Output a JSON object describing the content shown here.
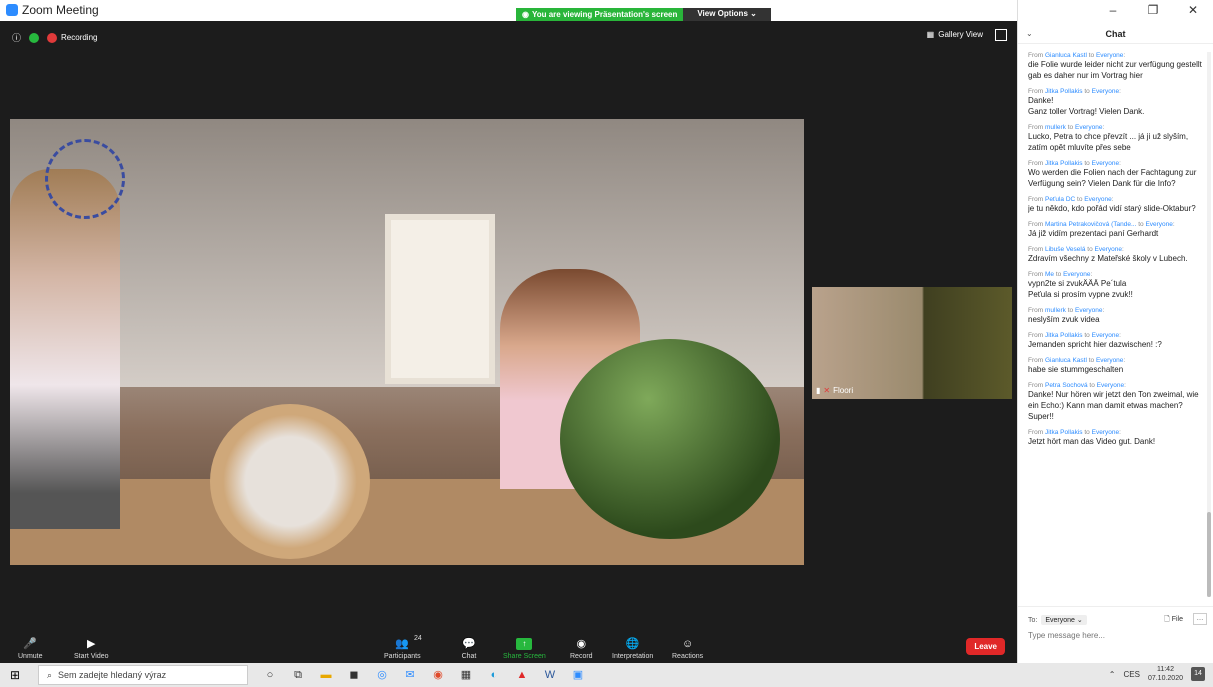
{
  "app": {
    "title": "Zoom Meeting"
  },
  "banner": {
    "viewing": "You are viewing Präsentation's screen",
    "view_options": "View Options ⌄"
  },
  "meeting": {
    "recording_label": "Recording",
    "gallery_label": "Gallery View",
    "thumbnail_name": "Floori"
  },
  "toolbar": {
    "unmute": "Unmute",
    "start_video": "Start Video",
    "participants": "Participants",
    "participants_count": "24",
    "chat": "Chat",
    "share": "Share Screen",
    "record": "Record",
    "interpretation": "Interpretation",
    "reactions": "Reactions",
    "leave": "Leave"
  },
  "chat": {
    "title": "Chat",
    "messages": [
      {
        "from": "Gianluca Kastl",
        "to": "Everyone",
        "text": "die Folie wurde leider nicht zur verfügung gestellt\ngab es daher nur im Vortrag hier"
      },
      {
        "from": "Jitka Pollakis",
        "to": "Everyone",
        "text": "Danke!\nGanz toller Vortrag! Vielen Dank."
      },
      {
        "from": "mullerk",
        "to": "Everyone",
        "text": "Lucko, Petra to chce převzít ... já ji už slyším, zatím opět mluvíte přes sebe"
      },
      {
        "from": "Jitka Pollakis",
        "to": "Everyone",
        "text": "Wo werden die Folien nach der Fachtagung zur Verfügung sein? Vielen Dank für die Info?"
      },
      {
        "from": "Peťula DC",
        "to": "Everyone",
        "text": "je tu někdo, kdo pořád vidí starý slide-Oktabur?"
      },
      {
        "from": "Martina Petrakovičová (Tande...",
        "to": "Everyone",
        "text": "Já již vidím prezentaci paní Gerhardt"
      },
      {
        "from": "Libuše Veselá",
        "to": "Everyone",
        "text": "Zdravím všechny z Mateřské školy v Lubech."
      },
      {
        "from": "Me",
        "to": "Everyone",
        "text": "vypn2te si zvukÄÄÄ Pe´tula\nPeťula si prosím vypne zvuk!!"
      },
      {
        "from": "mullerk",
        "to": "Everyone",
        "text": "neslyším zvuk videa"
      },
      {
        "from": "Jitka Pollakis",
        "to": "Everyone",
        "text": "Jemanden spricht hier dazwischen! :?"
      },
      {
        "from": "Gianluca Kastl",
        "to": "Everyone",
        "text": "habe sie stummgeschalten"
      },
      {
        "from": "Petra Sochová",
        "to": "Everyone",
        "text": "Danke! Nur hören wir jetzt den Ton zweimal, wie ein Echo:) Kann man damit etwas machen?\nSuper!!"
      },
      {
        "from": "Jitka Pollakis",
        "to": "Everyone",
        "text": "Jetzt hört man das Video gut. Dank!"
      }
    ],
    "to_label": "To:",
    "to_value": "Everyone ⌄",
    "file_label": "File",
    "placeholder": "Type message here..."
  },
  "taskbar": {
    "search_placeholder": "Sem zadejte hledaný výraz",
    "lang": "CES",
    "time": "11:42",
    "date": "07.10.2020",
    "notifications": "14"
  }
}
